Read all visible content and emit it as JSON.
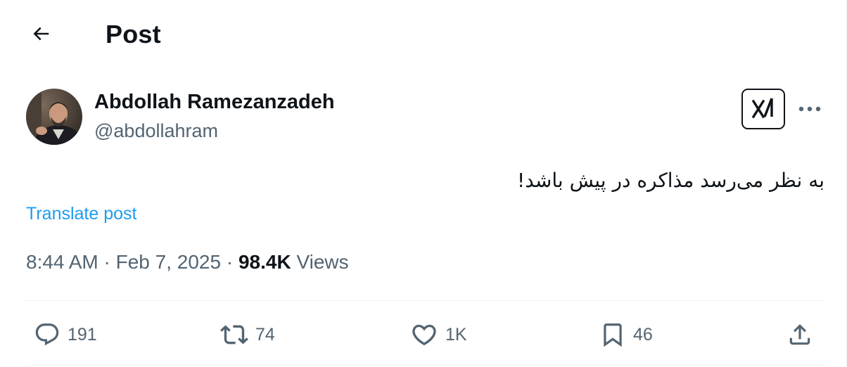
{
  "header": {
    "back_icon": "arrow-left-icon",
    "title": "Post"
  },
  "author": {
    "display_name": "Abdollah Ramezanzadeh",
    "handle": "@abdollahram",
    "avatar_icon": "avatar-photo"
  },
  "grok_icon": "grok-icon",
  "more_icon": "more-dots-icon",
  "post": {
    "text": "به نظر می‌رسد مذاکره در پیش باشد!",
    "translate_label": "Translate post",
    "time": "8:44 AM",
    "date": "Feb 7, 2025",
    "separator": "·",
    "views_count": "98.4K",
    "views_label": "Views"
  },
  "actions": {
    "reply": {
      "icon": "reply-icon",
      "count": "191"
    },
    "repost": {
      "icon": "repost-icon",
      "count": "74"
    },
    "like": {
      "icon": "heart-icon",
      "count": "1K"
    },
    "bookmark": {
      "icon": "bookmark-icon",
      "count": "46"
    },
    "share": {
      "icon": "share-icon"
    }
  },
  "colors": {
    "text_primary": "#0f1419",
    "text_secondary": "#536471",
    "link": "#1d9bf0",
    "border": "#eff3f4"
  }
}
